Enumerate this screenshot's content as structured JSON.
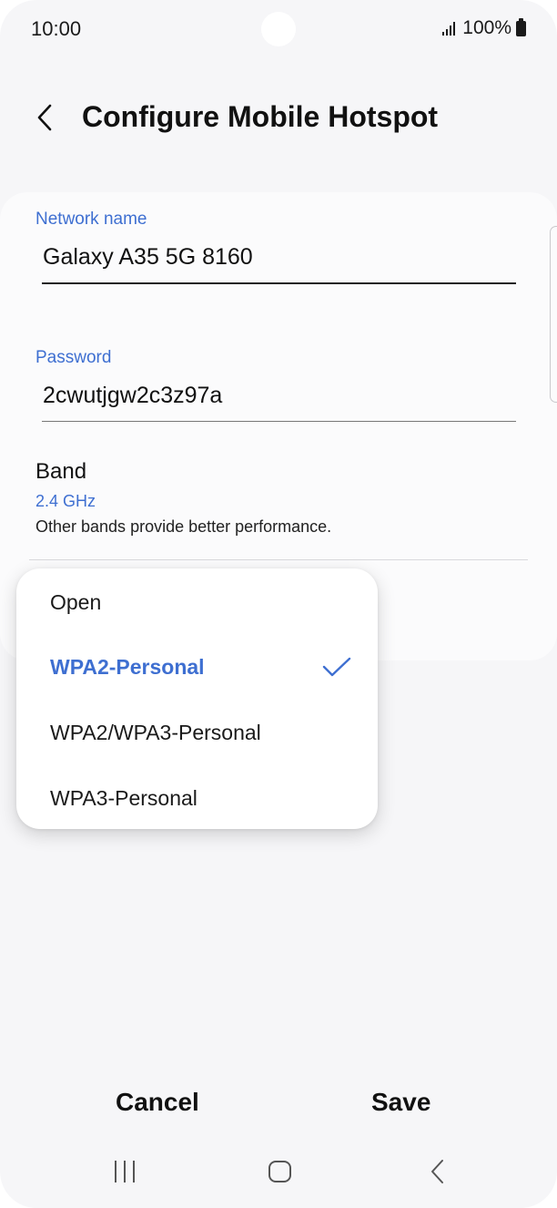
{
  "status_bar": {
    "time": "10:00",
    "battery_text": "100%",
    "signal_icon": "signal-bars-icon",
    "battery_icon": "battery-full-icon"
  },
  "header": {
    "title": "Configure Mobile Hotspot",
    "back_icon": "chevron-left-icon"
  },
  "form": {
    "network_name_label": "Network name",
    "network_name_value": "Galaxy A35 5G 8160",
    "password_label": "Password",
    "password_value": "2cwutjgw2c3z97a",
    "band_title": "Band",
    "band_value": "2.4 GHz",
    "band_hint": "Other bands provide better performance."
  },
  "security_dropdown": {
    "options": [
      "Open",
      "WPA2-Personal",
      "WPA2/WPA3-Personal",
      "WPA3-Personal"
    ],
    "selected": "WPA2-Personal",
    "check_icon": "checkmark-icon"
  },
  "actions": {
    "cancel": "Cancel",
    "save": "Save"
  },
  "nav_bar": {
    "recents_icon": "recents-icon",
    "home_icon": "home-icon",
    "back_icon": "nav-back-icon"
  },
  "colors": {
    "accent": "#3e6fd1",
    "background": "#f6f6f8",
    "card": "#fbfbfc",
    "text": "#111111"
  }
}
